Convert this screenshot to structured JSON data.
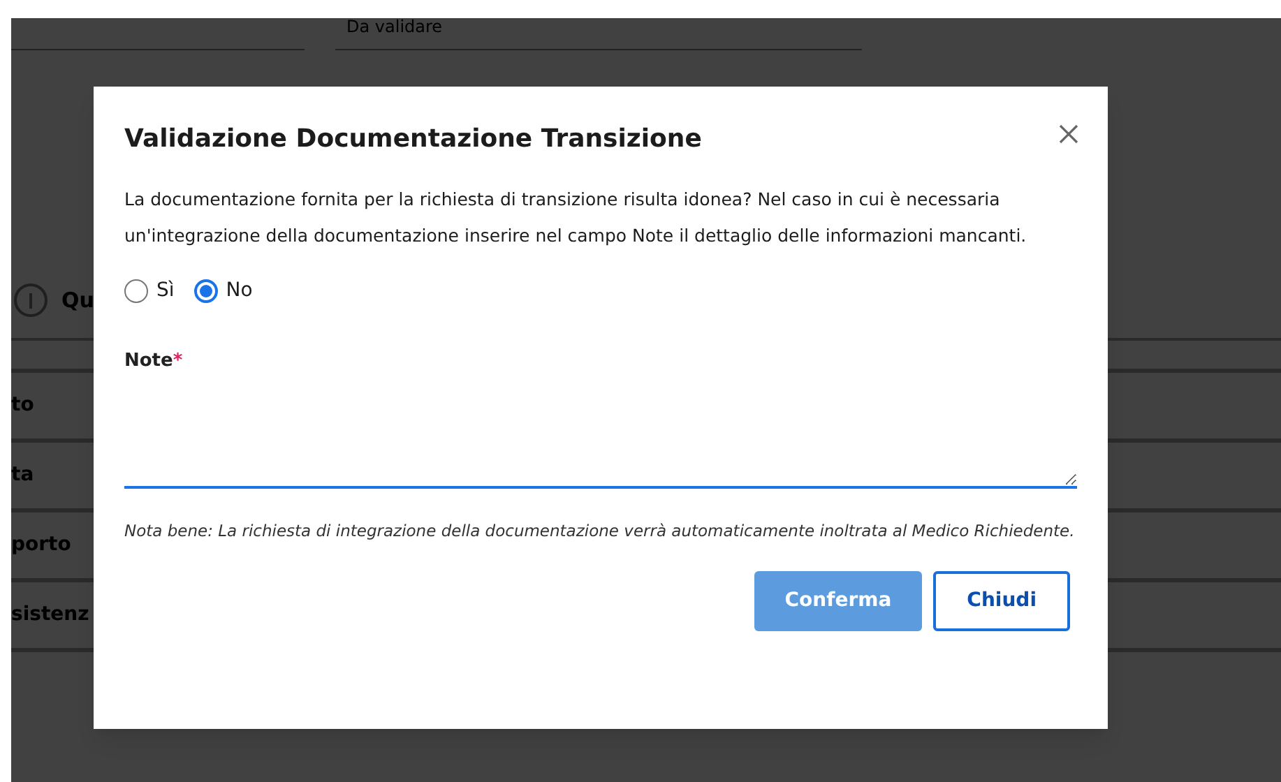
{
  "background": {
    "status_field": {
      "value": "Da validare"
    },
    "section_heading": "Qu",
    "nav_items": [
      "to",
      "ta",
      "porto",
      "sistenz"
    ]
  },
  "dialog": {
    "title": "Validazione Documentazione Transizione",
    "message": "La documentazione fornita per la richiesta di transizione risulta idonea? Nel caso in cui è necessaria un'integrazione della documentazione inserire nel campo Note il dettaglio delle informazioni mancanti.",
    "options": [
      {
        "label": "Sì",
        "selected": false
      },
      {
        "label": "No",
        "selected": true
      }
    ],
    "note_field": {
      "label": "Note",
      "required_mark": "*"
    },
    "footnote": "Nota bene: La richiesta di integrazione della documentazione verrà automaticamente inoltrata al Medico Richiedente.",
    "buttons": [
      {
        "label": "Conferma",
        "kind": "primary",
        "disabled": true
      },
      {
        "label": "Chiudi",
        "kind": "secondary",
        "disabled": false
      }
    ]
  }
}
